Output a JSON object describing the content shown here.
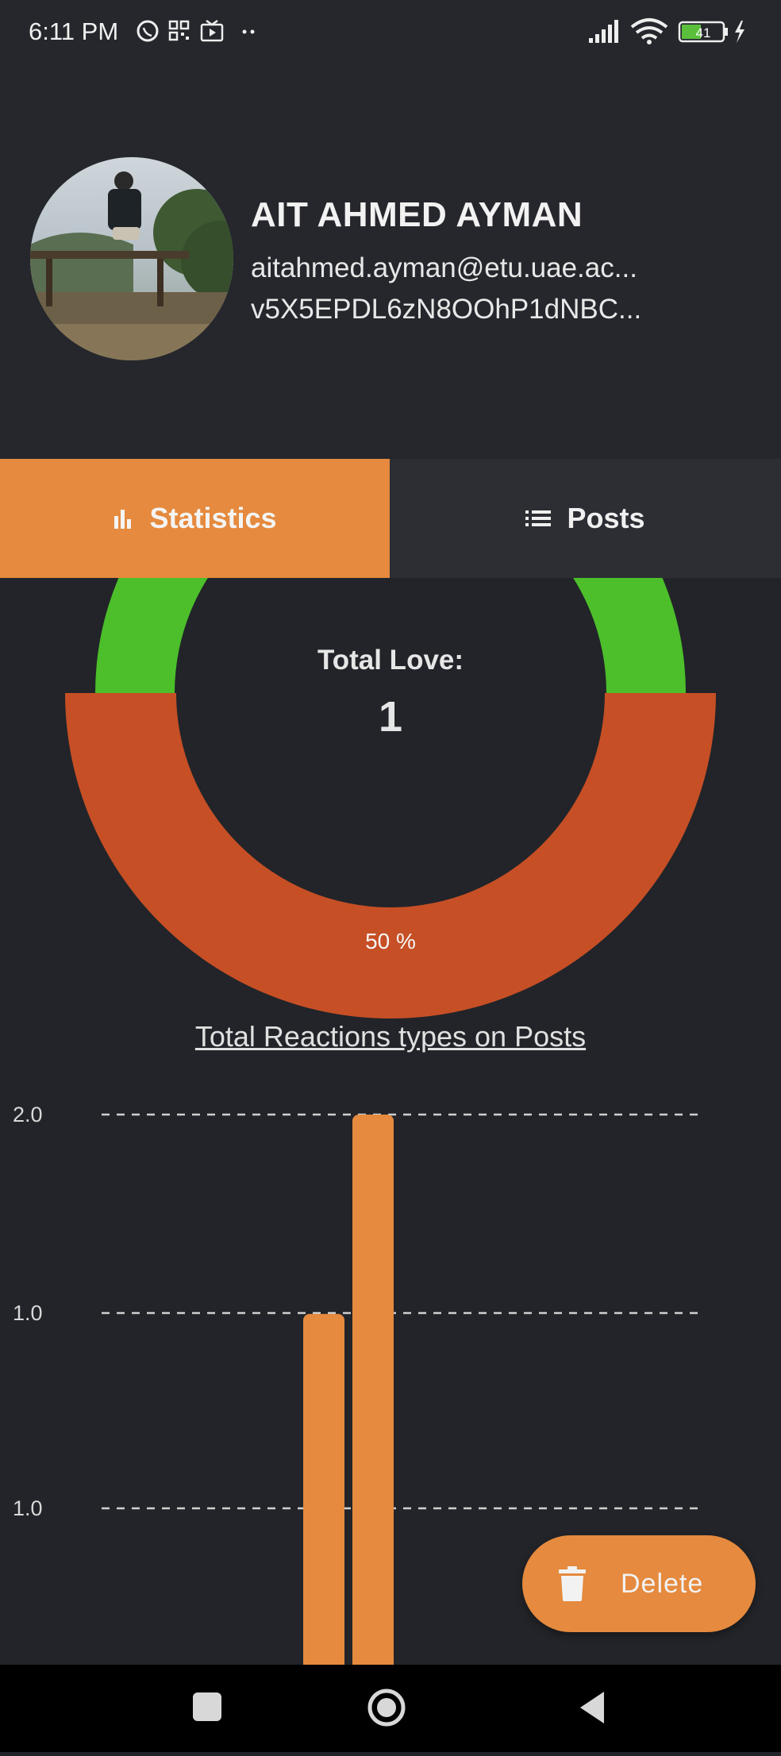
{
  "status_bar": {
    "time": "6:11 PM",
    "battery": "41"
  },
  "profile": {
    "name": "AIT AHMED AYMAN",
    "email": "aitahmed.ayman@etu.uae.ac...",
    "uid": "v5X5EPDL6zN8OOhP1dNBC..."
  },
  "tabs": [
    {
      "label": "Statistics",
      "icon": "bar-chart-icon",
      "active": true
    },
    {
      "label": "Posts",
      "icon": "list-icon",
      "active": false
    }
  ],
  "donut": {
    "label": "Total Love:",
    "value": "1",
    "percent_label": "50 %"
  },
  "colors": {
    "accent": "#e58a3e",
    "green": "#4cbf2a",
    "red": "#c64f25",
    "background": "#222429"
  },
  "chart_data": {
    "type": "bar",
    "title": "Total Reactions types on Posts",
    "y_tick_labels": [
      "2.0",
      "1.0",
      "1.0"
    ],
    "values": [
      1.42,
      2.0
    ],
    "ylim": [
      0,
      2.0
    ],
    "grid": "dashed horizontal"
  },
  "fab": {
    "label": "Delete",
    "icon": "trash-icon"
  }
}
